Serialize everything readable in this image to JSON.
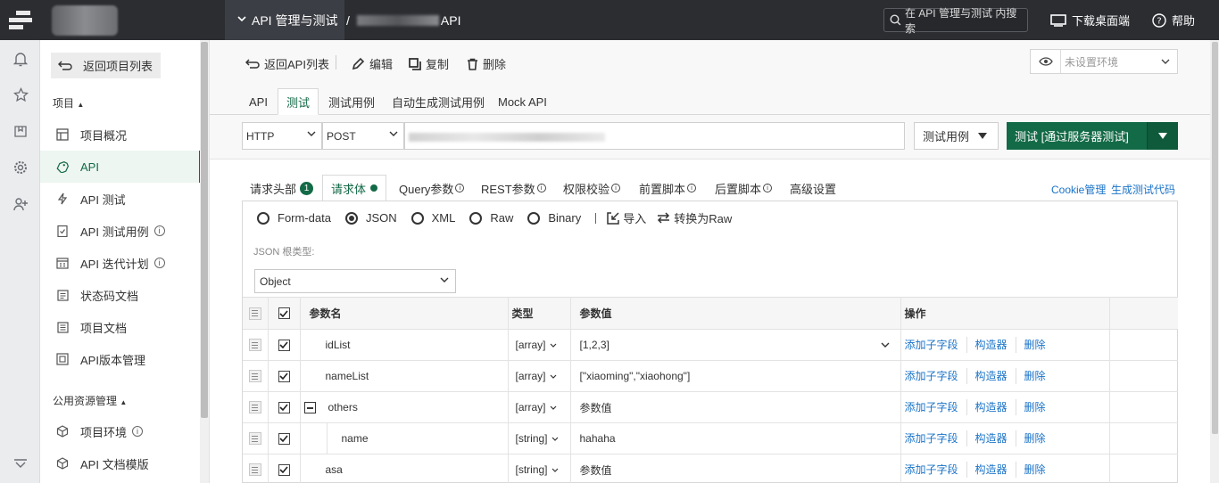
{
  "topbar": {
    "module": "API 管理与测试",
    "crumb_sep": "/",
    "crumb_suffix": "API",
    "search_placeholder": "在 API 管理与测试 内搜索",
    "download": "下载桌面端",
    "help": "帮助"
  },
  "sidebar": {
    "back": "返回项目列表",
    "section_project": "项目",
    "section_public": "公用资源管理",
    "items": [
      {
        "label": "项目概况",
        "icon": "dashboard-icon"
      },
      {
        "label": "API",
        "icon": "api-tag-icon"
      },
      {
        "label": "API 测试",
        "icon": "bolt-icon"
      },
      {
        "label": "API 测试用例",
        "icon": "checklist-icon"
      },
      {
        "label": "API 迭代计划",
        "icon": "calendar-icon"
      },
      {
        "label": "状态码文档",
        "icon": "doc-icon"
      },
      {
        "label": "项目文档",
        "icon": "book-icon"
      },
      {
        "label": "API版本管理",
        "icon": "version-icon"
      }
    ],
    "public_items": [
      {
        "label": "项目环境",
        "icon": "cube-icon"
      },
      {
        "label": "API 文档模版",
        "icon": "template-icon"
      }
    ]
  },
  "toolbar": {
    "back": "返回API列表",
    "edit": "编辑",
    "copy": "复制",
    "delete": "删除",
    "env_placeholder": "未设置环境"
  },
  "tabs": [
    "API",
    "测试",
    "测试用例",
    "自动生成测试用例",
    "Mock API"
  ],
  "request": {
    "protocol": "HTTP",
    "method": "POST",
    "case_btn": "测试用例",
    "run_btn": "测试 [通过服务器测试]"
  },
  "subtabs": {
    "headers": "请求头部",
    "headers_count": "1",
    "body": "请求体",
    "query": "Query参数",
    "rest": "REST参数",
    "auth": "权限校验",
    "pre": "前置脚本",
    "post": "后置脚本",
    "advanced": "高级设置",
    "cookie": "Cookie管理",
    "gen_code": "生成测试代码"
  },
  "body": {
    "formats": [
      "Form-data",
      "JSON",
      "XML",
      "Raw",
      "Binary"
    ],
    "selected_format": "JSON",
    "import": "导入",
    "to_raw": "转换为Raw",
    "root_label": "JSON 根类型:",
    "root_type": "Object"
  },
  "table": {
    "headers": {
      "name": "参数名",
      "type": "类型",
      "value": "参数值",
      "ops": "操作"
    },
    "op_add": "添加子字段",
    "op_builder": "构造器",
    "op_delete": "删除",
    "value_placeholder": "参数值",
    "rows": [
      {
        "name": "idList",
        "type": "[array]",
        "value": "[1,2,3]"
      },
      {
        "name": "nameList",
        "type": "[array]",
        "value": "[\"xiaoming\",\"xiaohong\"]"
      },
      {
        "name": "others",
        "type": "[array]",
        "value": ""
      },
      {
        "name": "name",
        "type": "[string]",
        "value": "hahaha"
      },
      {
        "name": "asa",
        "type": "[string]",
        "value": ""
      }
    ]
  },
  "colors": {
    "accent": "#136a47",
    "link": "#1a73c8",
    "topbar": "#2b2d31"
  }
}
